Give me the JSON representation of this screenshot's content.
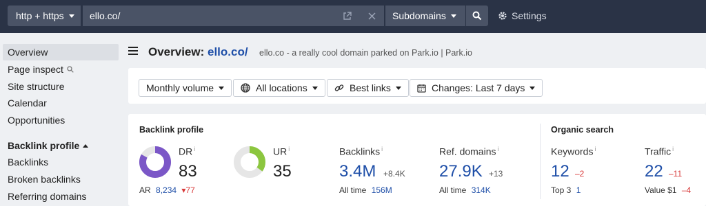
{
  "topbar": {
    "protocol": "http + https",
    "url": "ello.co/",
    "mode": "Subdomains",
    "settings": "Settings"
  },
  "sidebar": {
    "items": [
      {
        "label": "Overview",
        "active": true
      },
      {
        "label": "Page inspect"
      },
      {
        "label": "Site structure"
      },
      {
        "label": "Calendar"
      },
      {
        "label": "Opportunities"
      },
      {
        "label": "Backlink profile",
        "heading": true
      },
      {
        "label": "Backlinks"
      },
      {
        "label": "Broken backlinks"
      },
      {
        "label": "Referring domains"
      }
    ]
  },
  "header": {
    "title_prefix": "Overview:",
    "title_domain": "ello.co/",
    "subtitle": "ello.co - a really cool domain parked on Park.io | Park.io"
  },
  "filters": {
    "volume": "Monthly volume",
    "locations": "All locations",
    "links": "Best links",
    "changes": "Changes: Last 7 days"
  },
  "backlink_profile": {
    "title": "Backlink profile",
    "dr": {
      "label": "DR",
      "info": "i",
      "value": "83",
      "fraction": 0.83,
      "ar_label": "AR",
      "ar_value": "8,234",
      "ar_change": "▾77"
    },
    "ur": {
      "label": "UR",
      "info": "i",
      "value": "35",
      "fraction": 0.35
    },
    "backlinks": {
      "label": "Backlinks",
      "info": "i",
      "value": "3.4M",
      "change": "+8.4K",
      "foot_label": "All time",
      "foot_value": "156M"
    },
    "ref_domains": {
      "label": "Ref. domains",
      "info": "i",
      "value": "27.9K",
      "change": "+13",
      "foot_label": "All time",
      "foot_value": "314K"
    }
  },
  "organic_search": {
    "title": "Organic search",
    "keywords": {
      "label": "Keywords",
      "info": "i",
      "value": "12",
      "change": "–2",
      "foot_label": "Top 3",
      "foot_value": "1"
    },
    "traffic": {
      "label": "Traffic",
      "info": "i",
      "value": "22",
      "change": "–11",
      "foot_label": "Value",
      "foot_value": "$1",
      "foot_change": "–4"
    }
  },
  "colors": {
    "topbar": "#2a3346",
    "dr_ring": "#7b57c7",
    "ur_ring": "#8cc63f",
    "ring_track": "#e6e6e6",
    "link_blue": "#1f4fa8",
    "negative_red": "#d83a3a"
  }
}
